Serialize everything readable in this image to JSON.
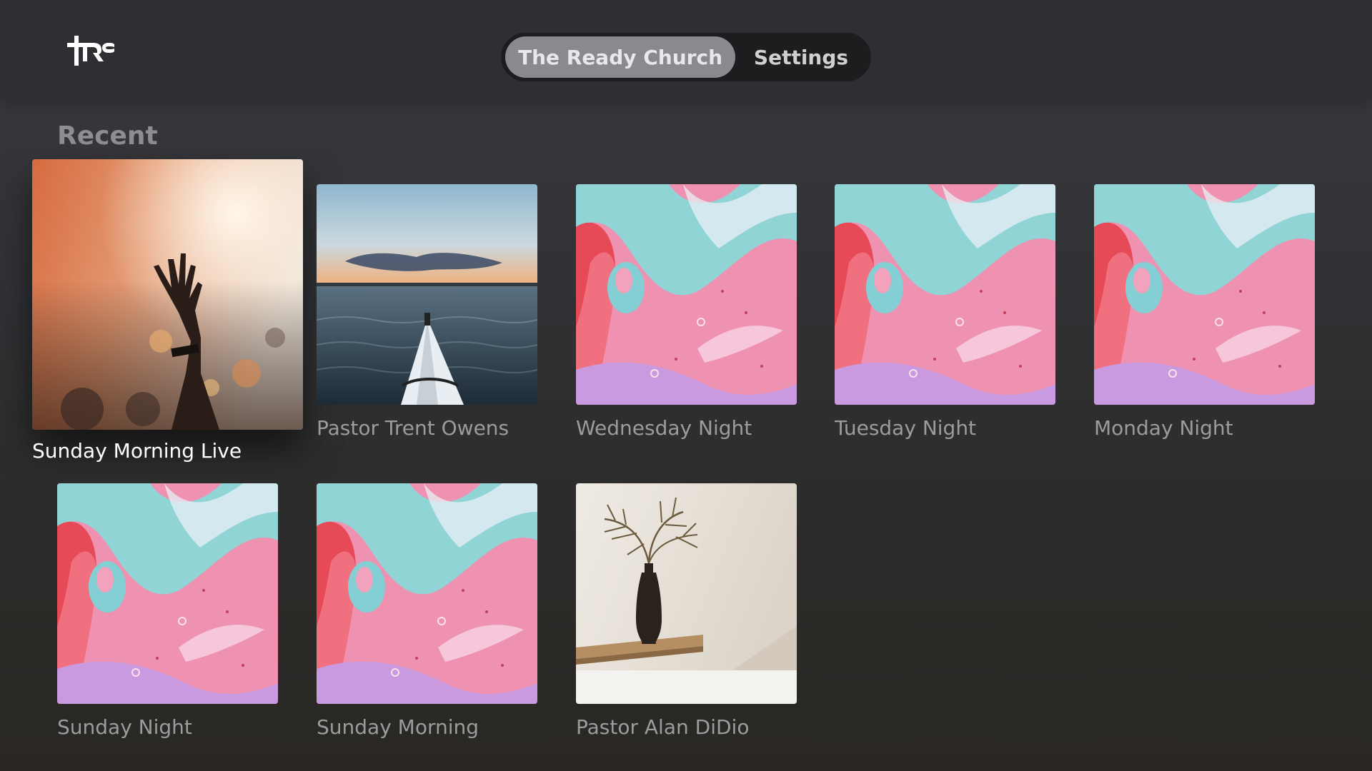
{
  "app": {
    "logo_text": "TRC"
  },
  "tabs": [
    {
      "label": "The Ready Church",
      "selected": true
    },
    {
      "label": "Settings",
      "selected": false
    }
  ],
  "recent": {
    "title": "Recent",
    "items": [
      {
        "title": "Sunday Morning Live",
        "artwork": "worship-hand-photo",
        "focused": true
      },
      {
        "title": "Pastor Trent Owens",
        "artwork": "kayak-sunset-photo",
        "focused": false
      },
      {
        "title": "Wednesday Night",
        "artwork": "pink-marble-art",
        "focused": false
      },
      {
        "title": "Tuesday Night",
        "artwork": "pink-marble-art",
        "focused": false
      },
      {
        "title": "Monday Night",
        "artwork": "pink-marble-art",
        "focused": false
      },
      {
        "title": "Sunday Night",
        "artwork": "pink-marble-art",
        "focused": false
      },
      {
        "title": "Sunday Morning",
        "artwork": "pink-marble-art",
        "focused": false
      },
      {
        "title": "Pastor Alan DiDio",
        "artwork": "vase-plant-photo",
        "focused": false
      }
    ]
  },
  "colors": {
    "background": "#303134",
    "topbar": "#2e2f32",
    "tab_selected": "#8a8a8e",
    "caption": "#9c9c9f",
    "caption_focused": "#ffffff"
  }
}
